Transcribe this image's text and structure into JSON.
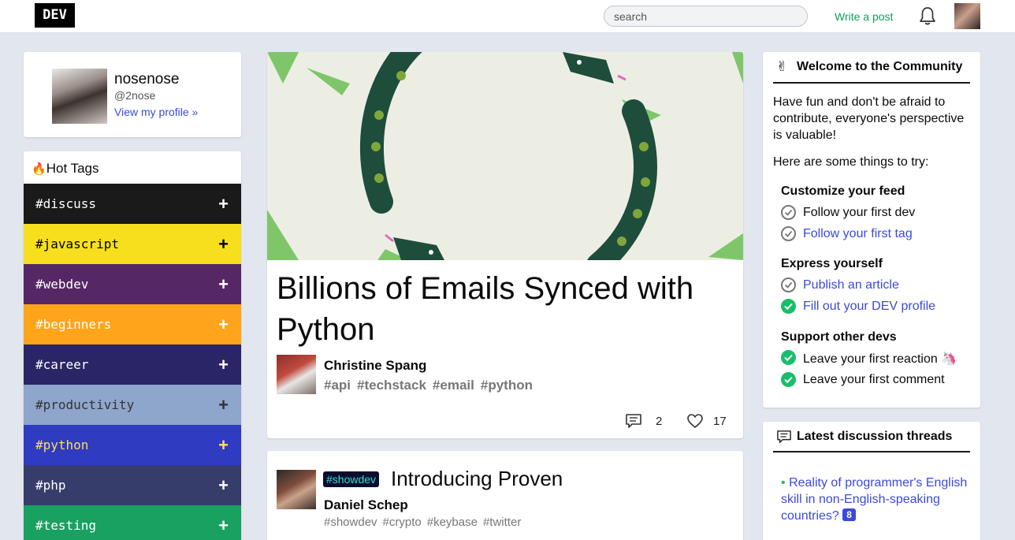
{
  "header": {
    "logo": "DEV",
    "search_placeholder": "search",
    "write_label": "Write a post"
  },
  "profile": {
    "name": "nosenose",
    "handle": "@2nose",
    "link": "View my profile »"
  },
  "hot_tags": {
    "title": "Hot Tags",
    "items": [
      {
        "label": "#discuss",
        "bg": "#1a1a1a",
        "fg": "#ffffff"
      },
      {
        "label": "#javascript",
        "bg": "#f7df1e",
        "fg": "#000000"
      },
      {
        "label": "#webdev",
        "bg": "#562765",
        "fg": "#ffffff"
      },
      {
        "label": "#beginners",
        "bg": "#ffa41b",
        "fg": "#ffffff"
      },
      {
        "label": "#career",
        "bg": "#2a2566",
        "fg": "#ffffff"
      },
      {
        "label": "#productivity",
        "bg": "#8ea5cc",
        "fg": "#333333"
      },
      {
        "label": "#python",
        "bg": "#2f3bc1",
        "fg": "#ffdf5b"
      },
      {
        "label": "#php",
        "bg": "#373d6b",
        "fg": "#ffffff"
      },
      {
        "label": "#testing",
        "bg": "#19a162",
        "fg": "#ffffff"
      }
    ]
  },
  "featured": {
    "title": "Billions of Emails Synced with Python",
    "author": "Christine Spang",
    "tags": [
      "#api",
      "#techstack",
      "#email",
      "#python"
    ],
    "comments": "2",
    "reactions": "17"
  },
  "post2": {
    "badge": "#showdev",
    "title": "Introducing Proven",
    "author": "Daniel Schep",
    "tags": [
      "#showdev",
      "#crypto",
      "#keybase",
      "#twitter"
    ]
  },
  "welcome": {
    "title": "Welcome to the Community",
    "intro": "Have fun and don't be afraid to contribute, everyone's perspective is valuable!",
    "try": "Here are some things to try:",
    "sections": [
      {
        "heading": "Customize your feed",
        "items": [
          {
            "label": "Follow your first dev",
            "done": false,
            "link": false
          },
          {
            "label": "Follow your first tag",
            "done": false,
            "link": true
          }
        ]
      },
      {
        "heading": "Express yourself",
        "items": [
          {
            "label": "Publish an article",
            "done": false,
            "link": true
          },
          {
            "label": "Fill out your DEV profile",
            "done": true,
            "link": true
          }
        ]
      },
      {
        "heading": "Support other devs",
        "items": [
          {
            "label": "Leave your first reaction",
            "done": true,
            "link": false
          },
          {
            "label": "Leave your first comment",
            "done": true,
            "link": false
          }
        ]
      }
    ]
  },
  "threads": {
    "title": "Latest discussion threads",
    "items": [
      {
        "label": "Reality of programmer's English skill in non-English-speaking countries?",
        "count": "8"
      }
    ]
  }
}
